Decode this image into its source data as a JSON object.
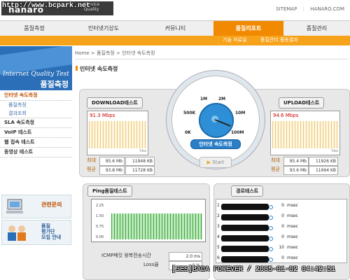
{
  "header": {
    "logo_wordmark": "hanaro",
    "logo_service": "Service Quality",
    "top_links": [
      "SITEMAP",
      "HANARO.COM"
    ]
  },
  "main_nav": [
    "품질측정",
    "인터넷기상도",
    "커뮤니티",
    "품질리포트",
    "품질관리"
  ],
  "main_nav_active": 3,
  "sub_nav": [
    "기술 자료실",
    "품질관리 활동결과"
  ],
  "sidebar": {
    "header_en": "Internet Quality Test",
    "header_ko": "품질측정",
    "menu": [
      {
        "label": "인터넷 속도측정",
        "active": true
      },
      {
        "label": "품질측정",
        "sub": true
      },
      {
        "label": "결과조회",
        "sub": true
      },
      {
        "label": "SLA 속도측정"
      },
      {
        "label": "VoIP 테스트"
      },
      {
        "label": "웹 접속 테스트"
      },
      {
        "label": "동영상 테스트"
      }
    ],
    "promo1": "관련문의",
    "promo2_lines": [
      "품질",
      "평가단",
      "모집 안내"
    ]
  },
  "breadcrumb": [
    "Home",
    "품질측정",
    "인터넷 속도측정"
  ],
  "page_title": "인터넷 속도측정",
  "download": {
    "label": "DOWNLOAD테스트",
    "speed": "91.3",
    "unit": "Mbps",
    "max_label": "최대",
    "max_mbps": "95.6 Mb",
    "max_kb": "11948 KB",
    "avg_label": "평균",
    "avg_mbps": "93.8 Mb",
    "avg_kb": "11728 KB",
    "axis_end": "Time"
  },
  "upload": {
    "label": "UPLOAD테스트",
    "speed": "94.6",
    "unit": "Mbps",
    "max_label": "최대",
    "max_mbps": "95.4 Mb",
    "max_kb": "11926 KB",
    "avg_label": "평균",
    "avg_mbps": "93.6 Mb",
    "avg_kb": "11694 KB",
    "axis_end": "Time"
  },
  "gauge": {
    "labels": [
      "1M",
      "2M",
      "500K",
      "10M",
      "0K",
      "100M"
    ],
    "caption": "인터넷 속도측정",
    "start": "Start"
  },
  "ping": {
    "label": "Ping품질테스트",
    "y_ticks": [
      "2.25",
      "1.50",
      "0.75",
      "0.00"
    ],
    "rtt_label": "ICMP패킷 왕복전송시간",
    "rtt_value": "2.0 ms",
    "loss_label": "Loss율",
    "loss_value": "0 %"
  },
  "route": {
    "label": "경로테스트",
    "hops": [
      {
        "n": "1",
        "ms": "0",
        "unit": "msec"
      },
      {
        "n": "2",
        "ms": "0",
        "unit": "msec"
      },
      {
        "n": "3",
        "ms": "0",
        "unit": "msec"
      },
      {
        "n": "4",
        "ms": "0",
        "unit": "msec"
      },
      {
        "n": "5",
        "ms": "10",
        "unit": "msec"
      },
      {
        "n": "6",
        "ms": "0",
        "unit": "msec"
      }
    ]
  },
  "overlays": {
    "top": "http://www.bcpark.net",
    "bottom": "[SES]BADA FOREVER / 2005-01-02 04:42:51"
  }
}
